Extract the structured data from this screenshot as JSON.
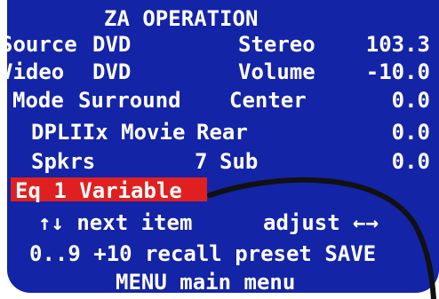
{
  "screen": {
    "title": "ZA OPERATION",
    "source": {
      "label": "Source",
      "value": "DVD"
    },
    "stereo": {
      "label": "Stereo",
      "value": "103.3"
    },
    "video": {
      "label": "Video",
      "value": "DVD"
    },
    "volume": {
      "label": "Volume",
      "value": "-10.0"
    },
    "mode": {
      "label": "Mode",
      "value": "Surround"
    },
    "center": {
      "label": "Center",
      "value": "0.0"
    },
    "dpl": {
      "value": "DPLIIx Movie"
    },
    "rear": {
      "label": "Rear",
      "value": "0.0"
    },
    "speakers": {
      "label": "Spkrs",
      "value": "7"
    },
    "sub": {
      "label": "Sub",
      "value": "0.0"
    },
    "eq": {
      "label": "Eq 1 Variable"
    },
    "help": {
      "line1_left": "↑↓ next item",
      "line1_right": "adjust ←→",
      "line2": "0..9 +10 recall preset SAVE",
      "line3": "MENU main menu"
    },
    "colors": {
      "background": "#1424a6",
      "highlight": "#e02020",
      "text": "#ffffff"
    }
  }
}
